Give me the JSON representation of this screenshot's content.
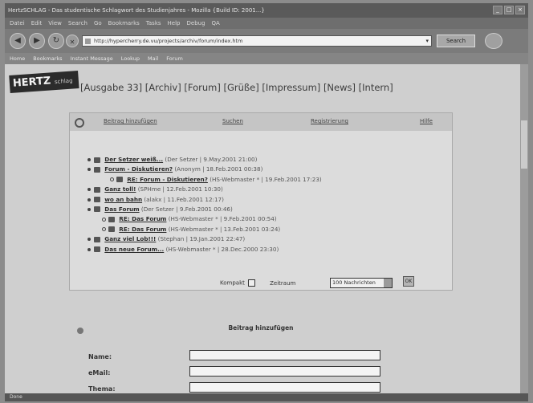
{
  "browser": {
    "title": "HertzSCHLAG - Das studentische Schlagwort des Studienjahres - Mozilla {Build ID: 2001...}",
    "window_buttons": [
      "_",
      "□",
      "×"
    ],
    "menu": [
      "Datei",
      "Edit",
      "View",
      "Search",
      "Go",
      "Bookmarks",
      "Tasks",
      "Help",
      "Debug",
      "QA"
    ],
    "url": "http://hypercherry.de.vu/projects/archiv/forum/index.htm",
    "search_label": "Search",
    "bookmarks": [
      "Home",
      "Bookmarks",
      "Instant Message",
      "Lookup",
      "Mail",
      "Forum"
    ],
    "status": "Done"
  },
  "site": {
    "logo": "HERTZ",
    "logo_sub": "schlag",
    "nav": [
      "[Ausgabe 33]",
      "[Archiv]",
      "[Forum]",
      "[Grüße]",
      "[Impressum]",
      "[News]",
      "[Intern]"
    ]
  },
  "forum": {
    "tabs": [
      "Beitrag hinzufügen",
      "Suchen",
      "Registrierung",
      "Hilfe"
    ],
    "threads": [
      {
        "title": "Der Setzer weiß...",
        "meta": "(Der Setzer | 9.May.2001 21:00)"
      },
      {
        "title": "Forum - Diskutieren?",
        "meta": "(Anonym | 18.Feb.2001 00:38)"
      },
      {
        "title": "RE: Forum - Diskutieren?",
        "meta": "(HS-Webmaster * | 19.Feb.2001 17:23)"
      },
      {
        "title": "Ganz toll!",
        "meta": "(SPHme | 12.Feb.2001 10:30)"
      },
      {
        "title": "wo an bahn",
        "meta": "(alakx | 11.Feb.2001 12:17)"
      },
      {
        "title": "Das Forum",
        "meta": "(Der Setzer | 9.Feb.2001 00:46)"
      },
      {
        "title": "RE: Das Forum",
        "meta": "(HS-Webmaster * | 9.Feb.2001 00:54)"
      },
      {
        "title": "RE: Das Forum",
        "meta": "(HS-Webmaster * | 13.Feb.2001 03:24)"
      },
      {
        "title": "Ganz viel Lob!!!",
        "meta": "(Stephan | 19.Jan.2001 22:47)"
      },
      {
        "title": "Das neue Forum...",
        "meta": "(HS-Webmaster * | 28.Dec.2000 23:30)"
      }
    ],
    "compact_label": "Kompakt",
    "filter_label": "Zeitraum",
    "filter_value": "100 Nachrichten",
    "go_label": "OK"
  },
  "form": {
    "title": "Beitrag hinzufügen",
    "fields": [
      {
        "label": "Name:"
      },
      {
        "label": "eMail:"
      },
      {
        "label": "Thema:"
      }
    ]
  }
}
